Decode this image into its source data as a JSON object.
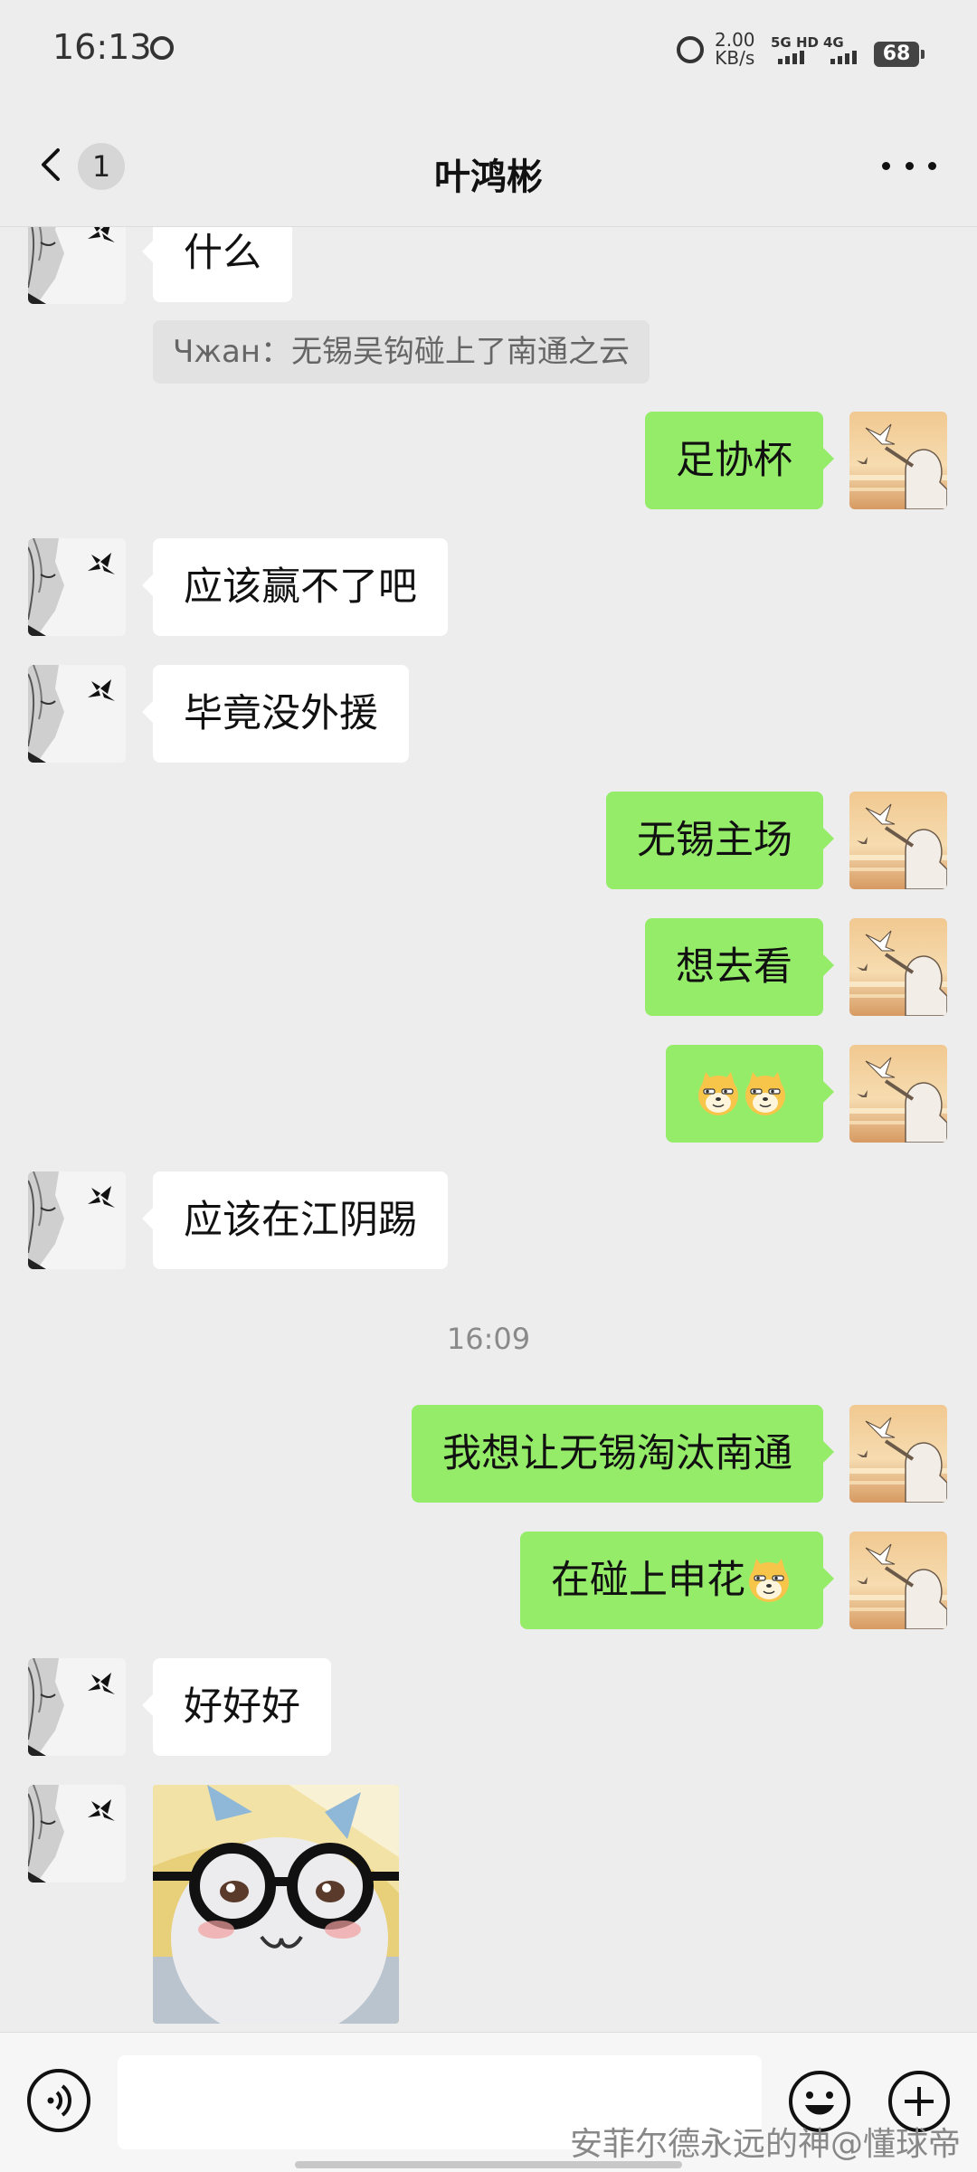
{
  "status_bar": {
    "time": "16:13",
    "speed_value": "2.00",
    "speed_unit": "KB/s",
    "sim1_type": "5G HD",
    "sim2_type": "4G",
    "battery": "68"
  },
  "header": {
    "unread_count": "1",
    "title": "叶鸿彬",
    "icons": [
      "back-icon",
      "more-icon"
    ]
  },
  "messages": [
    {
      "side": "left",
      "text": "什么"
    },
    {
      "side": "left",
      "type": "quote",
      "text": "Чжан：无锡吴钩碰上了南通之云"
    },
    {
      "side": "right",
      "text": "足协杯"
    },
    {
      "side": "left",
      "text": "应该赢不了吧"
    },
    {
      "side": "left",
      "text": "毕竟没外援"
    },
    {
      "side": "right",
      "text": "无锡主场"
    },
    {
      "side": "right",
      "text": "想去看"
    },
    {
      "side": "right",
      "type": "emoji",
      "emojis": [
        "doge-emoji",
        "doge-emoji"
      ]
    },
    {
      "side": "left",
      "text": "应该在江阴踢"
    },
    {
      "type": "timestamp",
      "text": "16:09"
    },
    {
      "side": "right",
      "text": "我想让无锡淘汰南通"
    },
    {
      "side": "right",
      "text": "在碰上申花",
      "emojis": [
        "doge-emoji"
      ]
    },
    {
      "side": "left",
      "text": "好好好"
    },
    {
      "side": "left",
      "type": "sticker",
      "sticker": "glasses-plush-sticker"
    }
  ],
  "input_bar": {
    "icons": [
      "voice-icon",
      "emoji-icon",
      "plus-icon"
    ],
    "watermark": "安菲尔德永远的神@懂球帝"
  },
  "colors": {
    "background": "#ededed",
    "sent_bubble": "#95ec69",
    "received_bubble": "#ffffff"
  }
}
